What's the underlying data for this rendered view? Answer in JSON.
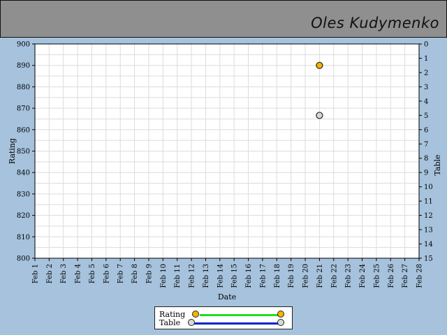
{
  "header": {
    "player_name": "Oles Kudymenko"
  },
  "chart_data": {
    "type": "scatter",
    "xlabel": "Date",
    "ylabel": "Rating",
    "y2label": "Table",
    "categories": [
      "Feb 1",
      "Feb 2",
      "Feb 3",
      "Feb 4",
      "Feb 5",
      "Feb 6",
      "Feb 7",
      "Feb 8",
      "Feb 9",
      "Feb 10",
      "Feb 11",
      "Feb 12",
      "Feb 13",
      "Feb 14",
      "Feb 15",
      "Feb 16",
      "Feb 17",
      "Feb 18",
      "Feb 19",
      "Feb 20",
      "Feb 21",
      "Feb 22",
      "Feb 23",
      "Feb 24",
      "Feb 25",
      "Feb 26",
      "Feb 27",
      "Feb 28"
    ],
    "ylim": [
      800,
      900
    ],
    "yticks": [
      800,
      810,
      820,
      830,
      840,
      850,
      860,
      870,
      880,
      890,
      900
    ],
    "y2lim": [
      0,
      15
    ],
    "y2_reversed": true,
    "y2ticks": [
      0,
      1,
      2,
      3,
      4,
      5,
      6,
      7,
      8,
      9,
      10,
      11,
      12,
      13,
      14,
      15
    ],
    "grid": true,
    "series": [
      {
        "name": "Rating",
        "axis": "left",
        "points": [
          {
            "x": "Feb 21",
            "y": 890
          }
        ],
        "marker_color": "#f5b400",
        "line_color": "#22dd22"
      },
      {
        "name": "Table",
        "axis": "right",
        "points": [
          {
            "x": "Feb 21",
            "y": 5
          }
        ],
        "marker_color": "#d8d8d8",
        "line_color": "#0022cc"
      }
    ]
  },
  "legend": {
    "items": [
      {
        "label": "Rating",
        "marker_color": "#f5b400",
        "line_color": "#22dd22"
      },
      {
        "label": "Table",
        "marker_color": "#d8d8d8",
        "line_color": "#0022cc"
      }
    ]
  }
}
